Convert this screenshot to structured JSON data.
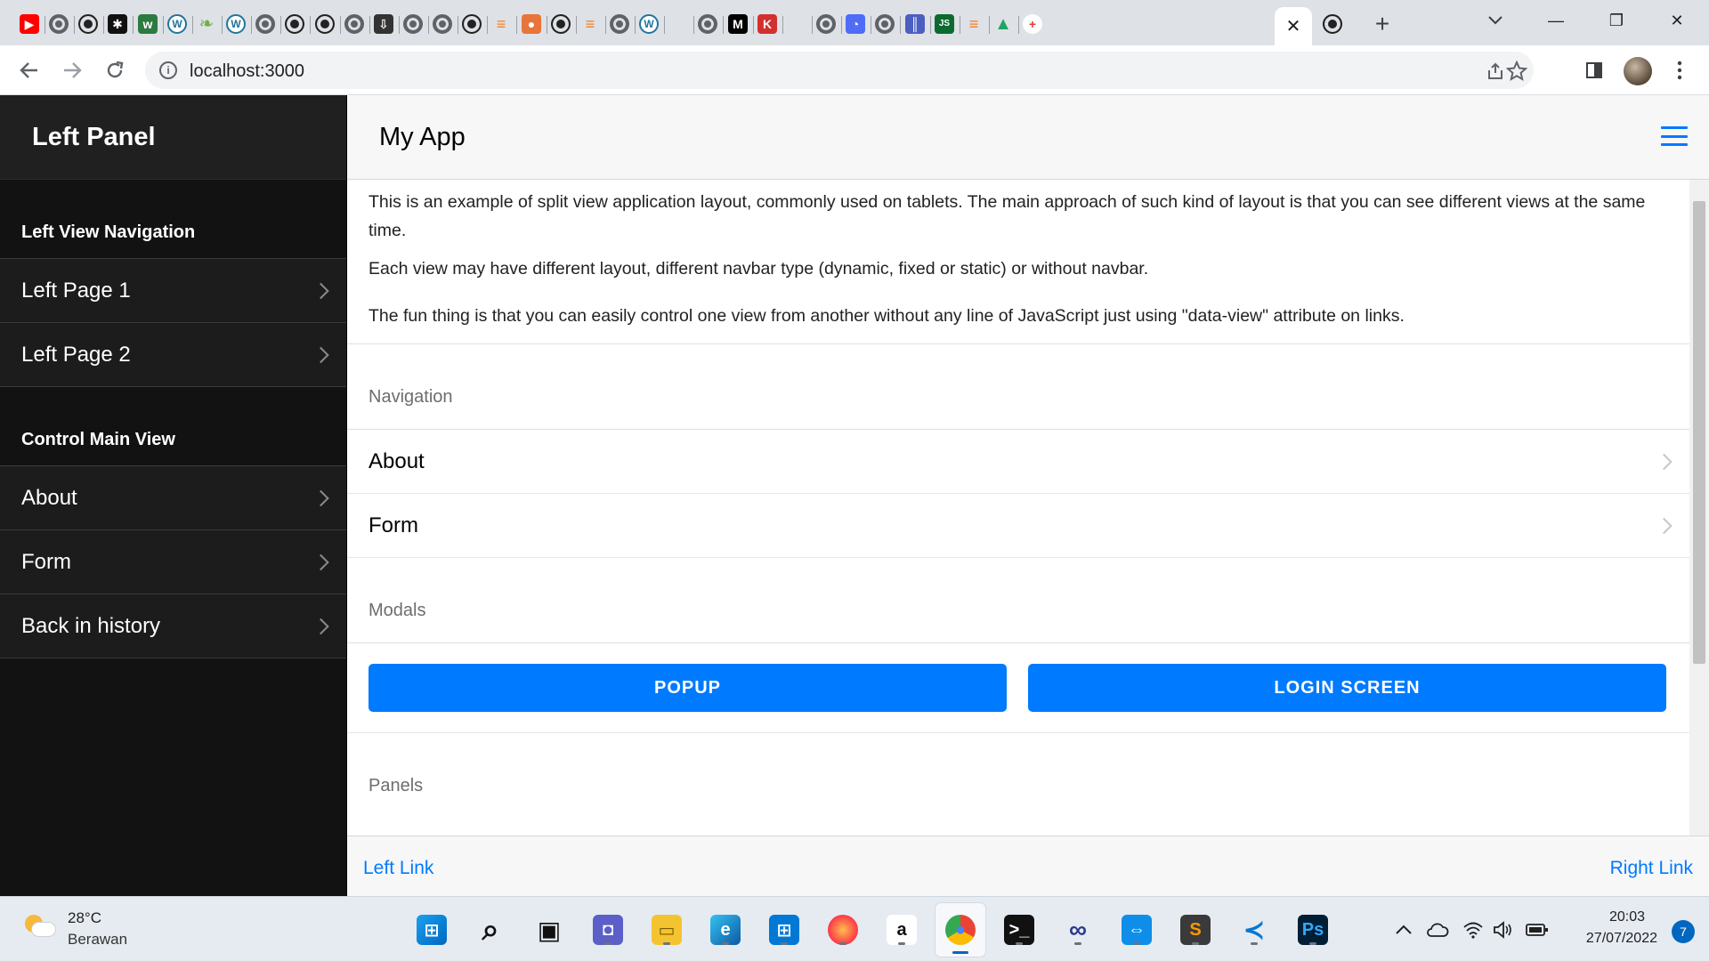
{
  "browser": {
    "url": "localhost:3000",
    "active_tab_close": "✕",
    "new_tab": "+",
    "tab_list_icon": "chevron-down-icon",
    "window_controls": {
      "minimize": "—",
      "restore": "❐",
      "close": "✕"
    },
    "tab_favicons": [
      {
        "icon": "youtube-icon",
        "color": "#ff0000"
      },
      {
        "icon": "globe-icon",
        "color": "#5f6368"
      },
      {
        "icon": "github-icon",
        "color": "#222222"
      },
      {
        "icon": "colorful-asterisk-icon",
        "color": "#111111"
      },
      {
        "icon": "w-logo-icon",
        "color": "#2c7a3f"
      },
      {
        "icon": "wordpress-icon",
        "color": "#21759b"
      },
      {
        "icon": "leaf-icon",
        "color": "#6db33f"
      },
      {
        "icon": "wordpress-icon",
        "color": "#21759b"
      },
      {
        "icon": "globe-icon",
        "color": "#5f6368"
      },
      {
        "icon": "github-icon",
        "color": "#222222"
      },
      {
        "icon": "github-icon",
        "color": "#222222"
      },
      {
        "icon": "globe-icon",
        "color": "#5f6368"
      },
      {
        "icon": "download-box-icon",
        "color": "#333333"
      },
      {
        "icon": "globe-icon",
        "color": "#5f6368"
      },
      {
        "icon": "globe-icon",
        "color": "#5f6368"
      },
      {
        "icon": "github-icon",
        "color": "#222222"
      },
      {
        "icon": "stackoverflow-icon",
        "color": "#f48024"
      },
      {
        "icon": "orange-circle-icon",
        "color": "#e8743b"
      },
      {
        "icon": "github-icon",
        "color": "#222222"
      },
      {
        "icon": "stackoverflow-icon",
        "color": "#f48024"
      },
      {
        "icon": "globe-icon",
        "color": "#5f6368"
      },
      {
        "icon": "wordpress-icon",
        "color": "#21759b"
      },
      {
        "icon": "microsoft-icon",
        "color": "#f25022"
      },
      {
        "icon": "globe-icon",
        "color": "#5f6368"
      },
      {
        "icon": "m-logo-icon",
        "color": "#000000"
      },
      {
        "icon": "k-logo-icon",
        "color": "#d32f2f"
      },
      {
        "icon": "microsoft-icon",
        "color": "#f25022"
      },
      {
        "icon": "globe-icon",
        "color": "#5f6368"
      },
      {
        "icon": "blue-swirl-icon",
        "color": "#4f6cf7"
      },
      {
        "icon": "globe-icon",
        "color": "#5f6368"
      },
      {
        "icon": "bars-icon",
        "color": "#4a5fc1"
      },
      {
        "icon": "js-logo-icon",
        "color": "#0b6b2f"
      },
      {
        "icon": "stackoverflow-icon",
        "color": "#f48024"
      },
      {
        "icon": "google-drive-icon",
        "color": "#1fa463"
      },
      {
        "icon": "red-plus-icon",
        "color": "#e53935"
      }
    ],
    "trailing_favicon": {
      "icon": "github-icon",
      "color": "#222222"
    }
  },
  "left_panel": {
    "title": "Left Panel",
    "sections": [
      {
        "title": "Left View Navigation",
        "items": [
          {
            "label": "Left Page 1"
          },
          {
            "label": "Left Page 2"
          }
        ]
      },
      {
        "title": "Control Main View",
        "items": [
          {
            "label": "About"
          },
          {
            "label": "Form"
          },
          {
            "label": "Back in history"
          }
        ]
      }
    ]
  },
  "main": {
    "title": "My App",
    "paragraphs": [
      "This is an example of split view application layout, commonly used on tablets. The main approach of such kind of layout is that you can see different views at the same time.",
      "Each view may have different layout, different navbar type (dynamic, fixed or static) or without navbar.",
      "The fun thing is that you can easily control one view from another without any line of JavaScript just using \"data-view\" attribute on links."
    ],
    "navigation": {
      "title": "Navigation",
      "items": [
        {
          "label": "About"
        },
        {
          "label": "Form"
        }
      ]
    },
    "modals": {
      "title": "Modals",
      "buttons": [
        {
          "label": "POPUP"
        },
        {
          "label": "LOGIN SCREEN"
        }
      ]
    },
    "panels": {
      "title": "Panels"
    },
    "toolbar": {
      "left_link": "Left Link",
      "right_link": "Right Link"
    }
  },
  "colors": {
    "accent": "#007aff",
    "left_panel_bg": "#121212",
    "left_navbar_bg": "#202020"
  },
  "taskbar": {
    "weather": {
      "temp": "28°C",
      "desc": "Berawan"
    },
    "apps": [
      {
        "icon": "windows-start-icon"
      },
      {
        "icon": "search-icon"
      },
      {
        "icon": "task-view-icon"
      },
      {
        "icon": "teams-chat-icon"
      },
      {
        "icon": "file-explorer-icon"
      },
      {
        "icon": "edge-icon"
      },
      {
        "icon": "microsoft-store-icon"
      },
      {
        "icon": "firefox-icon"
      },
      {
        "icon": "amazon-icon"
      },
      {
        "icon": "chrome-icon",
        "active": true
      },
      {
        "icon": "terminal-icon"
      },
      {
        "icon": "infinity-icon"
      },
      {
        "icon": "teamviewer-icon"
      },
      {
        "icon": "sublime-text-icon"
      },
      {
        "icon": "vscode-icon"
      },
      {
        "icon": "photoshop-icon"
      }
    ],
    "tray": [
      "chevron-up-icon",
      "cloud-icon",
      "wifi-icon",
      "speaker-icon",
      "battery-icon"
    ],
    "clock": {
      "time": "20:03",
      "date": "27/07/2022"
    },
    "notifications": "7"
  }
}
